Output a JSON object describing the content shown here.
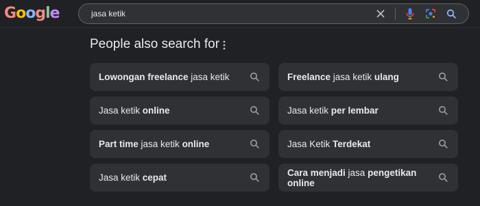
{
  "logo": {
    "letters": [
      "G",
      "o",
      "o",
      "g",
      "l",
      "e"
    ],
    "colors": [
      "#f28b82",
      "#fbbc04",
      "#8ab4f8",
      "#f28b82",
      "#81c995",
      "#c58af9"
    ]
  },
  "search": {
    "query": "jasa ketik",
    "icons": [
      "clear-icon",
      "mic-icon",
      "lens-icon",
      "search-icon"
    ],
    "accent": "#8ab4f8"
  },
  "section": {
    "title": "People also search for",
    "menu_icon": "more-vert-icon"
  },
  "suggestions": [
    [
      {
        "t": "Lowongan freelance",
        "b": true
      },
      {
        "t": " jasa ketik",
        "b": false
      }
    ],
    [
      {
        "t": "Freelance",
        "b": true
      },
      {
        "t": " jasa ketik ",
        "b": false
      },
      {
        "t": "ulang",
        "b": true
      }
    ],
    [
      {
        "t": "Jasa ketik ",
        "b": false
      },
      {
        "t": "online",
        "b": true
      }
    ],
    [
      {
        "t": "Jasa ketik ",
        "b": false
      },
      {
        "t": "per lembar",
        "b": true
      }
    ],
    [
      {
        "t": "Part time",
        "b": true
      },
      {
        "t": " jasa ketik ",
        "b": false
      },
      {
        "t": "online",
        "b": true
      }
    ],
    [
      {
        "t": "Jasa Ketik ",
        "b": false
      },
      {
        "t": "Terdekat",
        "b": true
      }
    ],
    [
      {
        "t": "Jasa ketik ",
        "b": false
      },
      {
        "t": "cepat",
        "b": true
      }
    ],
    [
      {
        "t": "Cara menjadi",
        "b": true
      },
      {
        "t": " jasa ",
        "b": false
      },
      {
        "t": "pengetikan online",
        "b": true
      }
    ]
  ],
  "colors": {
    "background": "#202124",
    "card": "#303134",
    "text": "#e8eaed",
    "icon": "#9aa0a6"
  }
}
